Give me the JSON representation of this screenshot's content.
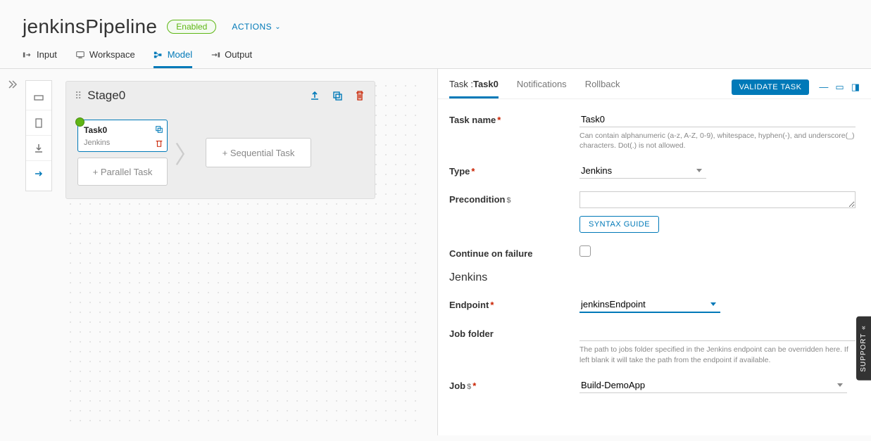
{
  "header": {
    "title": "jenkinsPipeline",
    "status": "Enabled",
    "actions_label": "ACTIONS"
  },
  "main_tabs": [
    {
      "label": "Input"
    },
    {
      "label": "Workspace"
    },
    {
      "label": "Model"
    },
    {
      "label": "Output"
    }
  ],
  "stage": {
    "name": "Stage0",
    "task": {
      "name": "Task0",
      "type": "Jenkins"
    },
    "add_parallel": "+ Parallel Task",
    "add_sequential": "+ Sequential Task"
  },
  "panel": {
    "tabs": {
      "task_prefix": "Task :",
      "task_name": "Task0",
      "notifications": "Notifications",
      "rollback": "Rollback"
    },
    "validate": "VALIDATE TASK",
    "form": {
      "task_name": {
        "label": "Task name",
        "value": "Task0",
        "hint": "Can contain alphanumeric (a-z, A-Z, 0-9), whitespace, hyphen(-), and underscore(_) characters. Dot(.) is not allowed."
      },
      "type": {
        "label": "Type",
        "value": "Jenkins"
      },
      "precondition": {
        "label": "Precondition",
        "value": "",
        "syntax": "SYNTAX GUIDE"
      },
      "continue": {
        "label": "Continue on failure"
      },
      "section": "Jenkins",
      "endpoint": {
        "label": "Endpoint",
        "value": "jenkinsEndpoint"
      },
      "job_folder": {
        "label": "Job folder",
        "value": "",
        "hint": "The path to jobs folder specified in the Jenkins endpoint can be overridden here. If left blank it will take the path from the endpoint if available."
      },
      "job": {
        "label": "Job",
        "value": "Build-DemoApp"
      }
    }
  },
  "support": "SUPPORT"
}
